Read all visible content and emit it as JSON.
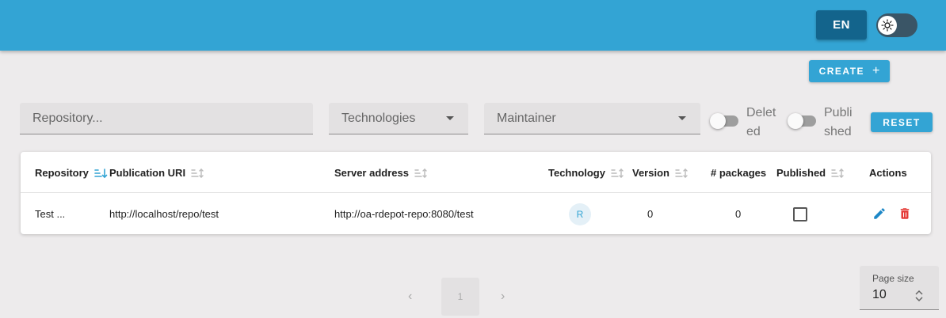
{
  "header": {
    "language_label": "EN",
    "theme_toggle_icon": "sun-icon"
  },
  "toolbar": {
    "create_label": "CREATE",
    "create_icon": "+",
    "reset_label": "RESET"
  },
  "filters": {
    "repository_placeholder": "Repository...",
    "technologies_placeholder": "Technologies",
    "maintainer_placeholder": "Maintainer",
    "deleted_label_1": "Delet",
    "deleted_label_2": "ed",
    "published_label_1": "Publi",
    "published_label_2": "shed"
  },
  "table": {
    "columns": [
      {
        "label": "Repository",
        "sort": "active"
      },
      {
        "label": "Publication URI",
        "sort": "inactive"
      },
      {
        "label": "Server address",
        "sort": "inactive"
      },
      {
        "label": "Technology",
        "sort": "inactive"
      },
      {
        "label": "Version",
        "sort": "inactive"
      },
      {
        "label": "# packages",
        "sort": "none"
      },
      {
        "label": "Published",
        "sort": "inactive"
      },
      {
        "label": "Actions",
        "sort": "none"
      }
    ],
    "rows": [
      {
        "repository": "Test ...",
        "publication_uri": "http://localhost/repo/test",
        "server_address": "http://oa-rdepot-repo:8080/test",
        "technology": "R",
        "version": "0",
        "packages": "0",
        "published": false
      }
    ]
  },
  "pagination": {
    "prev": "‹",
    "current_page": "1",
    "next": "›",
    "page_size_label": "Page size",
    "page_size_value": "10"
  },
  "colors": {
    "primary": "#33a4d4",
    "primary_dark": "#13648c",
    "danger": "#e53935",
    "background": "#edebec"
  }
}
